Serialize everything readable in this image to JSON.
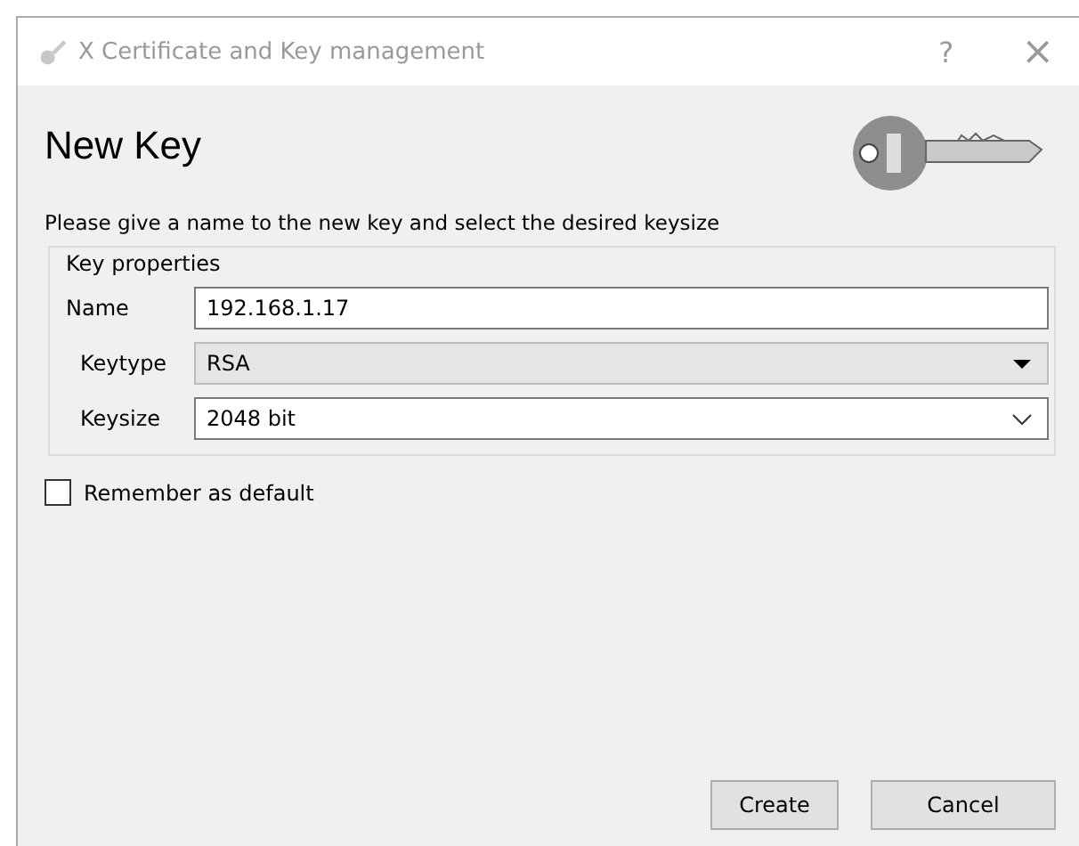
{
  "window": {
    "title": "X Certificate and Key management",
    "help": "?",
    "close": "×"
  },
  "heading": "New Key",
  "instruction": "Please give a name to the new key and select the desired keysize",
  "group": {
    "title": "Key properties",
    "fields": [
      {
        "kind": "text",
        "label": "Name",
        "value": "192.168.1.17"
      },
      {
        "kind": "combo",
        "label": "Keytype",
        "value": "RSA"
      },
      {
        "kind": "dropdown",
        "label": "Keysize",
        "value": "2048 bit"
      }
    ]
  },
  "remember": {
    "label": "Remember as default",
    "checked": false
  },
  "buttons": [
    "Create",
    "Cancel"
  ]
}
